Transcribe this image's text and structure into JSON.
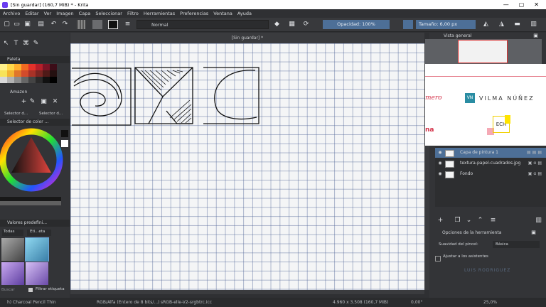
{
  "titlebar": {
    "title": "[Sin guardar]  (160,7 MiB)  * - Krita",
    "minimize": "—",
    "maximize": "▢",
    "close": "✕"
  },
  "menu": [
    "Archivo",
    "Editar",
    "Ver",
    "Imagen",
    "Capa",
    "Seleccionar",
    "Filtro",
    "Herramientas",
    "Preferencias",
    "Ventana",
    "Ayuda"
  ],
  "toolbar": {
    "blend_mode": "Normal",
    "opacity": "Opacidad: 100%",
    "size": "Tamaño: 6,00 px"
  },
  "left": {
    "palette_title": "Paleta",
    "palette_name": "Amazon",
    "palette_btn1": "Selector d...",
    "palette_btn2": "Selector d...",
    "color_selector_title": "Selector de color ...",
    "presets_title": "Valores predefini...",
    "presets_filter": "Todas",
    "presets_tag": "Eti...eta",
    "search_label": "Buscar",
    "filter_tag_label": "Filtrar etiqueta"
  },
  "canvas": {
    "tab_title": "[Sin guardar]  *"
  },
  "right": {
    "overview_title": "Vista general",
    "overlay_brand": "VILMA NÚÑEZ",
    "overlay_vn": "VN",
    "overlay_ech": "ECH",
    "overlay_left1": "mero",
    "overlay_left2": "na",
    "layers": [
      {
        "name": "Capa de pintura 1"
      },
      {
        "name": "textura-papel-cuadrados.jpg"
      },
      {
        "name": "Fondo"
      }
    ],
    "tool_options_title": "Opciones de la herramienta",
    "smoothing_label": "Suavidad del pincel:",
    "smoothing_value": "Básica",
    "assist_label": "Ajustar a los asistentes",
    "watermark": "LUIS RODRIGUEZ"
  },
  "status": {
    "brush": "h) Charcoal Pencil Thin",
    "color_mode": "RGB/Alfa (Entero de 8 bits/...)",
    "profile": "sRGB-elle-V2-srgbtrc.icc",
    "dimensions": "4.960 x 3.508 (160,7 MiB)",
    "angle": "0,00°",
    "zoom": "25,0%"
  },
  "colors": {
    "accent_blue": "#4d6f97",
    "panel": "#333437",
    "title_red": "#d33"
  }
}
